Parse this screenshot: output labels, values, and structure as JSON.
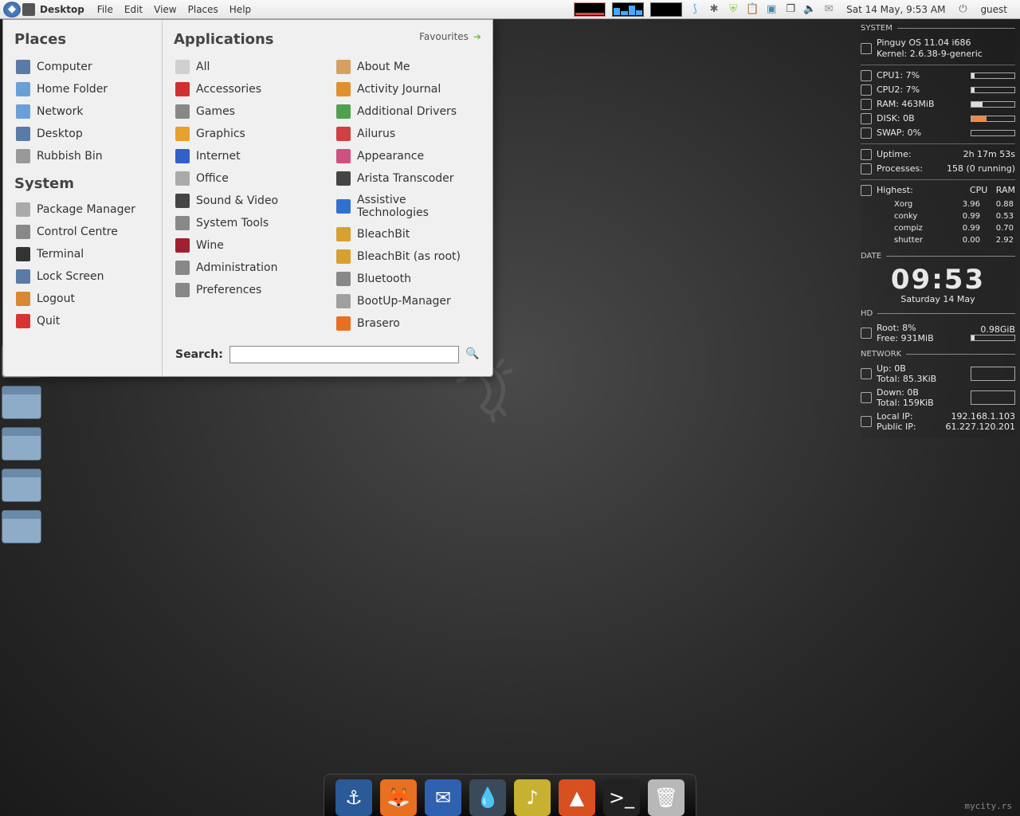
{
  "panel": {
    "desktop_label": "Desktop",
    "menus": [
      "File",
      "Edit",
      "View",
      "Places",
      "Help"
    ],
    "clock": "Sat 14 May,  9:53 AM",
    "user": "guest"
  },
  "menu": {
    "places_title": "Places",
    "system_title": "System",
    "apps_title": "Applications",
    "favourites": "Favourites",
    "search_label": "Search:",
    "places": [
      {
        "label": "Computer",
        "icon": "#5a7aa8"
      },
      {
        "label": "Home Folder",
        "icon": "#6aa0d8"
      },
      {
        "label": "Network",
        "icon": "#6aa0d8"
      },
      {
        "label": "Desktop",
        "icon": "#5a7aa8"
      },
      {
        "label": "Rubbish Bin",
        "icon": "#999999"
      }
    ],
    "system": [
      {
        "label": "Package Manager",
        "icon": "#aaaaaa"
      },
      {
        "label": "Control Centre",
        "icon": "#888888"
      },
      {
        "label": "Terminal",
        "icon": "#333333"
      },
      {
        "label": "Lock Screen",
        "icon": "#5a7aa8"
      },
      {
        "label": "Logout",
        "icon": "#d88833"
      },
      {
        "label": "Quit",
        "icon": "#d83333"
      }
    ],
    "categories": [
      {
        "label": "All",
        "icon": "#d0d0d0"
      },
      {
        "label": "Accessories",
        "icon": "#d03030"
      },
      {
        "label": "Games",
        "icon": "#888888"
      },
      {
        "label": "Graphics",
        "icon": "#e8a030"
      },
      {
        "label": "Internet",
        "icon": "#3060c8"
      },
      {
        "label": "Office",
        "icon": "#aaaaaa"
      },
      {
        "label": "Sound & Video",
        "icon": "#444444"
      },
      {
        "label": "System Tools",
        "icon": "#888888"
      },
      {
        "label": "Wine",
        "icon": "#a02030"
      },
      {
        "label": "Administration",
        "icon": "#888888"
      },
      {
        "label": "Preferences",
        "icon": "#888888"
      }
    ],
    "apps": [
      {
        "label": "About Me",
        "icon": "#d8a060"
      },
      {
        "label": "Activity Journal",
        "icon": "#e09030"
      },
      {
        "label": "Additional Drivers",
        "icon": "#50a050"
      },
      {
        "label": "Ailurus",
        "icon": "#d04040"
      },
      {
        "label": "Appearance",
        "icon": "#d05080"
      },
      {
        "label": "Arista Transcoder",
        "icon": "#444444"
      },
      {
        "label": "Assistive Technologies",
        "icon": "#3070d0"
      },
      {
        "label": "BleachBit",
        "icon": "#d8a030"
      },
      {
        "label": "BleachBit (as root)",
        "icon": "#d8a030"
      },
      {
        "label": "Bluetooth",
        "icon": "#888888"
      },
      {
        "label": "BootUp-Manager",
        "icon": "#a0a0a0"
      },
      {
        "label": "Brasero",
        "icon": "#e87020"
      }
    ]
  },
  "conky": {
    "section_system": "SYSTEM",
    "os": "Pinguy OS 11.04 i686",
    "kernel": "Kernel: 2.6.38-9-generic",
    "cpu1_label": "CPU1: 7%",
    "cpu2_label": "CPU2: 7%",
    "ram_label": "RAM: 463MiB",
    "disk_label": "DISK: 0B",
    "swap_label": "SWAP: 0%",
    "uptime_label": "Uptime:",
    "uptime_val": "2h 17m 53s",
    "proc_label": "Processes:",
    "proc_val": "158 (0 running)",
    "highest_label": "Highest:",
    "col_cpu": "CPU",
    "col_ram": "RAM",
    "procs": [
      {
        "name": "Xorg",
        "cpu": "3.96",
        "ram": "0.88"
      },
      {
        "name": "conky",
        "cpu": "0.99",
        "ram": "0.53"
      },
      {
        "name": "compiz",
        "cpu": "0.99",
        "ram": "0.70"
      },
      {
        "name": "shutter",
        "cpu": "0.00",
        "ram": "2.92"
      }
    ],
    "section_date": "DATE",
    "time": "09:53",
    "date": "Saturday 14 May",
    "section_hd": "HD",
    "root_label": "Root: 8%",
    "root_val": "0.98GiB",
    "free_label": "Free: 931MiB",
    "section_net": "NETWORK",
    "up_label": "Up: 0B",
    "up_total": "Total: 85.3KiB",
    "down_label": "Down: 0B",
    "down_total": "Total: 159KiB",
    "local_ip_label": "Local IP:",
    "local_ip": "192.168.1.103",
    "public_ip_label": "Public IP:",
    "public_ip": "61.227.120.201"
  },
  "watermark": "mycity.rs",
  "side_dock": [
    "documents-folder",
    "music-folder",
    "pictures-folder",
    "videos-folder",
    "downloads-folder"
  ],
  "bottom_dock": [
    {
      "name": "docky",
      "bg": "#2a5a98",
      "glyph": "⚓"
    },
    {
      "name": "firefox",
      "bg": "#e87020",
      "glyph": "🦊"
    },
    {
      "name": "thunderbird",
      "bg": "#3060b0",
      "glyph": "✉"
    },
    {
      "name": "deluge",
      "bg": "#3a4a5a",
      "glyph": "💧"
    },
    {
      "name": "rhythmbox",
      "bg": "#c8b030",
      "glyph": "♪"
    },
    {
      "name": "vlc",
      "bg": "#d85020",
      "glyph": "▲"
    },
    {
      "name": "terminal",
      "bg": "#222222",
      "glyph": ">_"
    },
    {
      "name": "trash",
      "bg": "#b8b8b8",
      "glyph": "🗑"
    }
  ]
}
